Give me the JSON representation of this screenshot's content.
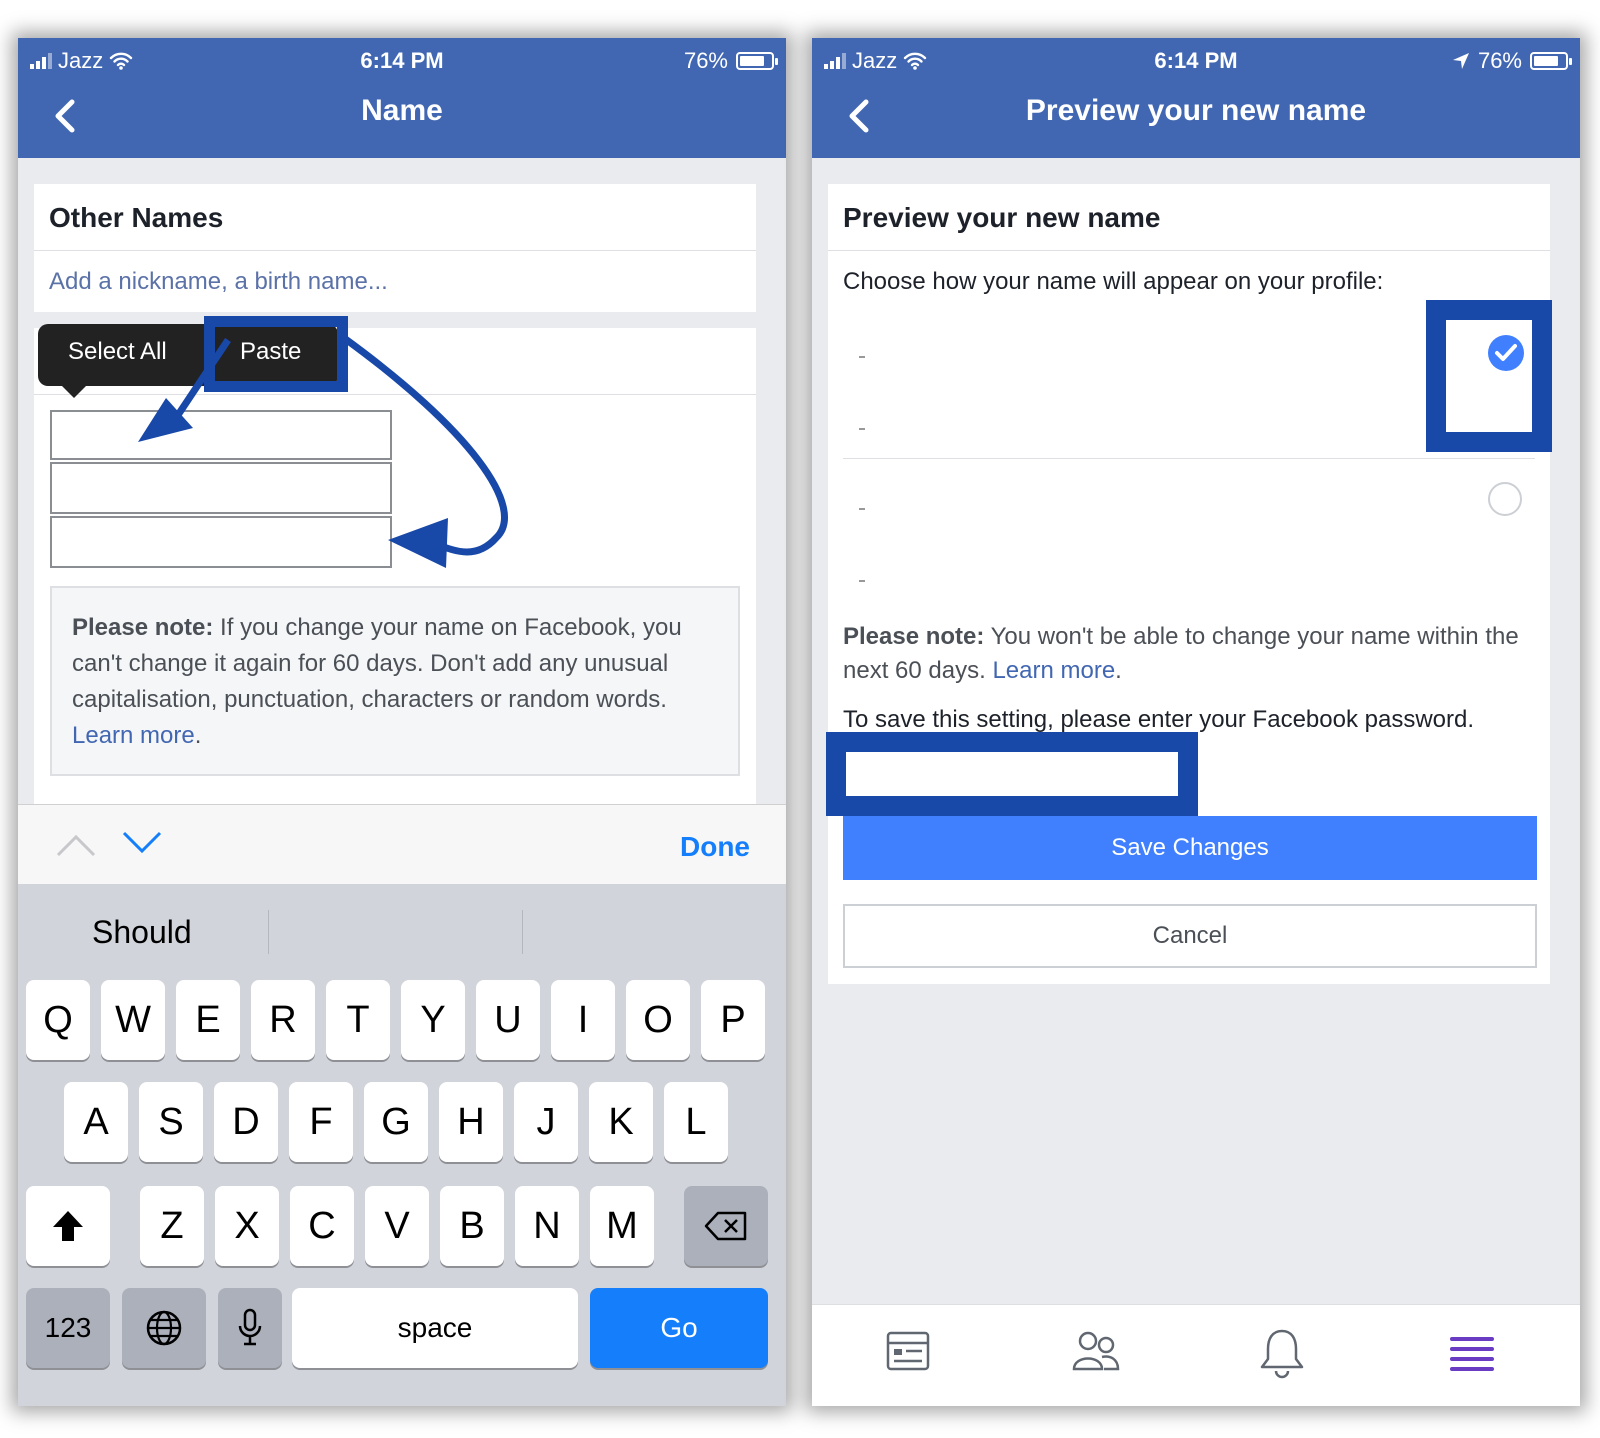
{
  "left": {
    "status": {
      "carrier": "Jazz",
      "time": "6:14 PM",
      "battery": "76%"
    },
    "title": "Name",
    "other_names": {
      "heading": "Other Names",
      "placeholder": "Add a nickname, a birth name..."
    },
    "context_menu": {
      "select_all": "Select All",
      "paste": "Paste"
    },
    "note": {
      "bold": "Please note:",
      "text": " If you change your name on Facebook, you can't change it again for 60 days. Don't add any unusual capitalisation, punctuation, characters or random words. ",
      "link": "Learn more",
      "end": "."
    },
    "toolbar": {
      "done": "Done"
    },
    "suggestion": "Should",
    "keyboard": {
      "row1": [
        "Q",
        "W",
        "E",
        "R",
        "T",
        "Y",
        "U",
        "I",
        "O",
        "P"
      ],
      "row2": [
        "A",
        "S",
        "D",
        "F",
        "G",
        "H",
        "J",
        "K",
        "L"
      ],
      "row3": [
        "Z",
        "X",
        "C",
        "V",
        "B",
        "N",
        "M"
      ],
      "numbers": "123",
      "space": "space",
      "go": "Go"
    }
  },
  "right": {
    "status": {
      "carrier": "Jazz",
      "time": "6:14 PM",
      "battery": "76%"
    },
    "title": "Preview your new name",
    "card_title": "Preview your new name",
    "instruction": "Choose how your name will appear on your profile:",
    "option_1_selected": true,
    "note": {
      "bold": "Please note:",
      "text": " You won't be able to change your name within the next 60 days. ",
      "link": "Learn more",
      "end": "."
    },
    "password_prompt": "To save this setting, please enter your Facebook password.",
    "save_button": "Save Changes",
    "cancel_button": "Cancel",
    "tabs": [
      "news-feed-icon",
      "friends-icon",
      "notifications-icon",
      "menu-icon"
    ]
  },
  "colors": {
    "facebook_blue": "#4267b2",
    "highlight_blue": "#1848a8",
    "ios_blue": "#147efb",
    "save_blue": "#4080ff"
  }
}
